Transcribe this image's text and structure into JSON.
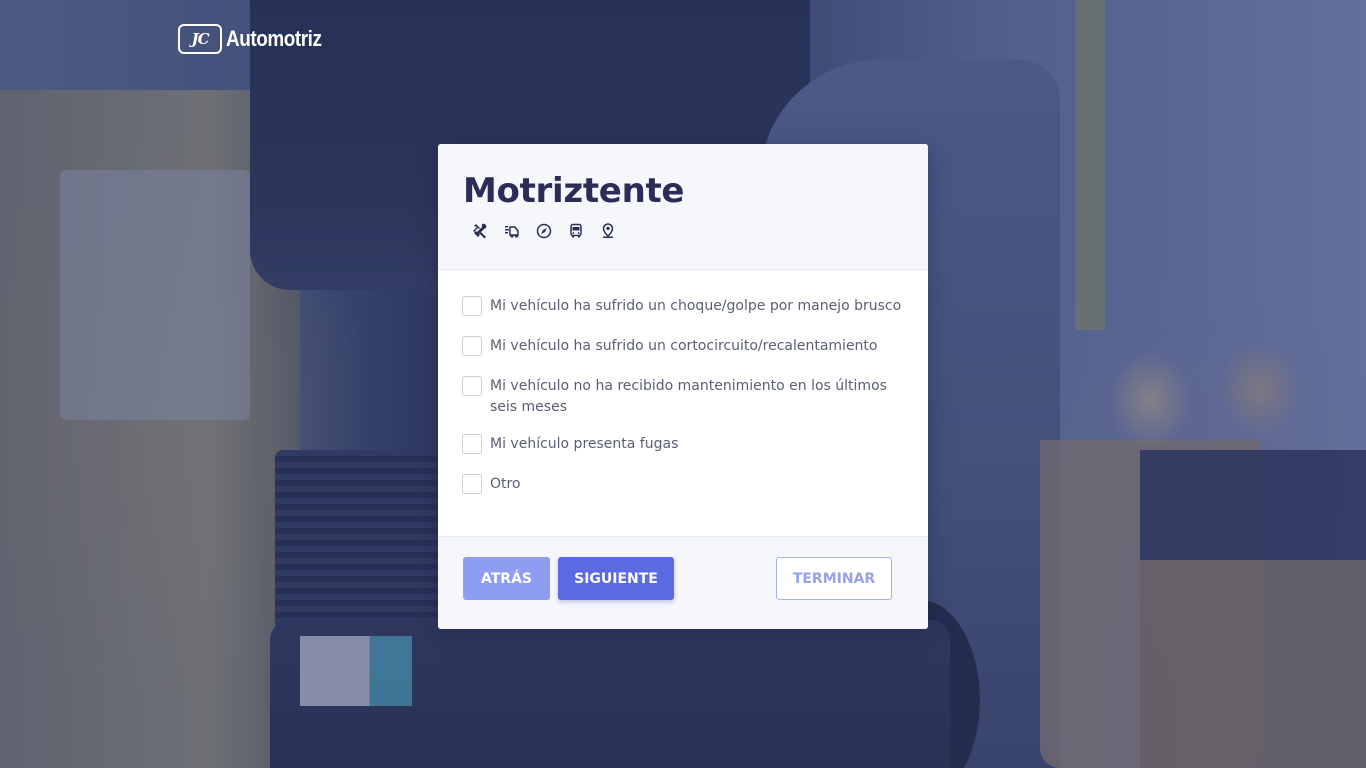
{
  "logo": {
    "mark": "JC",
    "text": "Automotriz"
  },
  "card": {
    "title": "Motriztente",
    "icons": [
      "tools-icon",
      "tow-truck-icon",
      "compass-icon",
      "bus-icon",
      "location-pin-icon"
    ]
  },
  "options": [
    {
      "label": "Mi vehículo ha sufrido un choque/golpe por manejo brusco",
      "checked": false
    },
    {
      "label": "Mi vehículo ha sufrido un cortocircuito/recalentamiento",
      "checked": false
    },
    {
      "label": "Mi vehículo no ha recibido mantenimiento en los últimos seis meses",
      "checked": false
    },
    {
      "label": "Mi vehículo presenta fugas",
      "checked": false
    },
    {
      "label": "Otro",
      "checked": false
    }
  ],
  "footer": {
    "back_label": "ATRÁS",
    "next_label": "SIGUIENTE",
    "finish_label": "TERMINAR"
  },
  "colors": {
    "title": "#2d2c57",
    "primary": "#5b69e3",
    "primary_light": "#8e9df0"
  }
}
